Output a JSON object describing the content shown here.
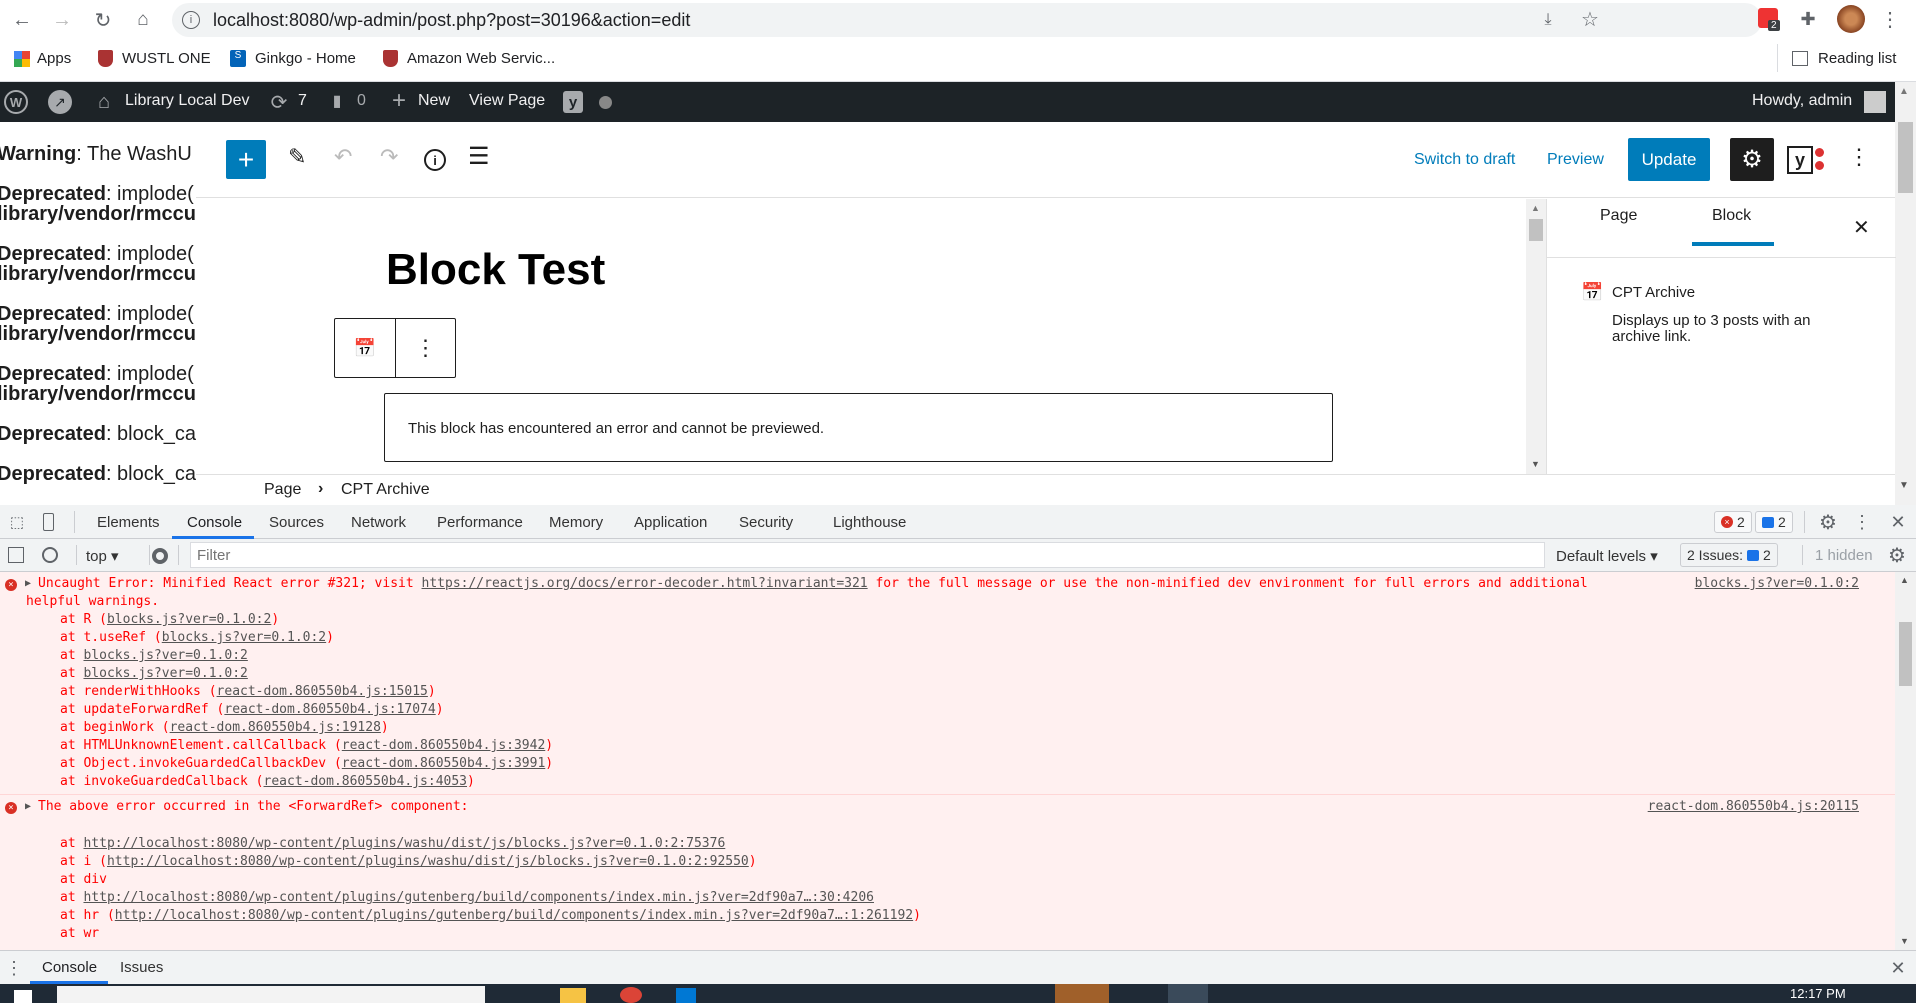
{
  "browser": {
    "url": "localhost:8080/wp-admin/post.php?post=30196&action=edit",
    "extension_badge": "2",
    "bookmarks": [
      {
        "label": "Apps"
      },
      {
        "label": "WUSTL ONE"
      },
      {
        "label": "Ginkgo - Home"
      },
      {
        "label": "Amazon Web Servic..."
      }
    ],
    "reading_list": "Reading list"
  },
  "admin_bar": {
    "site_name": "Library Local Dev",
    "updates_count": "7",
    "comments_count": "0",
    "new_label": "New",
    "view_page": "View Page",
    "howdy": "Howdy, admin"
  },
  "php_notices": [
    {
      "label": "Warning",
      "text": ": The WashU",
      "line2": ""
    },
    {
      "label": "Deprecated",
      "text": ": implode(",
      "line2": "library/vendor/rmccu"
    },
    {
      "label": "Deprecated",
      "text": ": implode(",
      "line2": "library/vendor/rmccu"
    },
    {
      "label": "Deprecated",
      "text": ": implode(",
      "line2": "library/vendor/rmccu"
    },
    {
      "label": "Deprecated",
      "text": ": implode(",
      "line2": "library/vendor/rmccu"
    },
    {
      "label": "Deprecated",
      "text": ": block_ca",
      "line2": ""
    },
    {
      "label": "Deprecated",
      "text": ": block_ca",
      "line2": ""
    }
  ],
  "editor": {
    "switch_to_draft": "Switch to draft",
    "preview": "Preview",
    "update": "Update",
    "accent": "#007cba",
    "title": "Block Test",
    "block_error": "This block has encountered an error and cannot be previewed.",
    "breadcrumb": [
      "Page",
      "CPT Archive"
    ]
  },
  "sidebar": {
    "tabs": [
      {
        "label": "Page",
        "active": false
      },
      {
        "label": "Block",
        "active": true
      }
    ],
    "block_name": "CPT Archive",
    "block_description": "Displays up to 3 posts with an archive link."
  },
  "devtools": {
    "tabs": [
      "Elements",
      "Console",
      "Sources",
      "Network",
      "Performance",
      "Memory",
      "Application",
      "Security",
      "Lighthouse"
    ],
    "active_tab": "Console",
    "error_count": "2",
    "message_count": "2",
    "context": "top",
    "filter_placeholder": "Filter",
    "levels": "Default levels",
    "issues_label": "2 Issues:",
    "issues_count": "2",
    "hidden": "1 hidden",
    "drawer_tabs": [
      "Console",
      "Issues"
    ]
  },
  "console": {
    "messages": [
      {
        "text": "Uncaught Error: Minified React error #321; visit ",
        "link": "https://reactjs.org/docs/error-decoder.html?invariant=321",
        "text_after": " for the full message or use the non-minified dev environment for full errors and additional",
        "line2": "helpful warnings.",
        "source": "blocks.js?ver=0.1.0:2",
        "stack": [
          {
            "fn": "R",
            "loc": "blocks.js?ver=0.1.0:2"
          },
          {
            "fn": "t.useRef",
            "loc": "blocks.js?ver=0.1.0:2"
          },
          {
            "fn": "",
            "loc": "blocks.js?ver=0.1.0:2"
          },
          {
            "fn": "",
            "loc": "blocks.js?ver=0.1.0:2"
          },
          {
            "fn": "renderWithHooks",
            "loc": "react-dom.860550b4.js:15015"
          },
          {
            "fn": "updateForwardRef",
            "loc": "react-dom.860550b4.js:17074"
          },
          {
            "fn": "beginWork",
            "loc": "react-dom.860550b4.js:19128"
          },
          {
            "fn": "HTMLUnknownElement.callCallback",
            "loc": "react-dom.860550b4.js:3942"
          },
          {
            "fn": "Object.invokeGuardedCallbackDev",
            "loc": "react-dom.860550b4.js:3991"
          },
          {
            "fn": "invokeGuardedCallback",
            "loc": "react-dom.860550b4.js:4053"
          }
        ]
      },
      {
        "text": "The above error occurred in the <ForwardRef> component:",
        "source": "react-dom.860550b4.js:20115",
        "stack": [
          {
            "fn": "",
            "loc": "http://localhost:8080/wp-content/plugins/washu/dist/js/blocks.js?ver=0.1.0:2:75376"
          },
          {
            "fn": "i",
            "loc": "http://localhost:8080/wp-content/plugins/washu/dist/js/blocks.js?ver=0.1.0:2:92550"
          },
          {
            "fn": "div",
            "loc": ""
          },
          {
            "fn": "",
            "loc": "http://localhost:8080/wp-content/plugins/gutenberg/build/components/index.min.js?ver=2df90a7…:30:4206"
          },
          {
            "fn": "hr",
            "loc": "http://localhost:8080/wp-content/plugins/gutenberg/build/components/index.min.js?ver=2df90a7…:1:261192"
          },
          {
            "fn": "wr",
            "loc": ""
          }
        ]
      }
    ]
  },
  "taskbar": {
    "time": "12:17 PM"
  }
}
